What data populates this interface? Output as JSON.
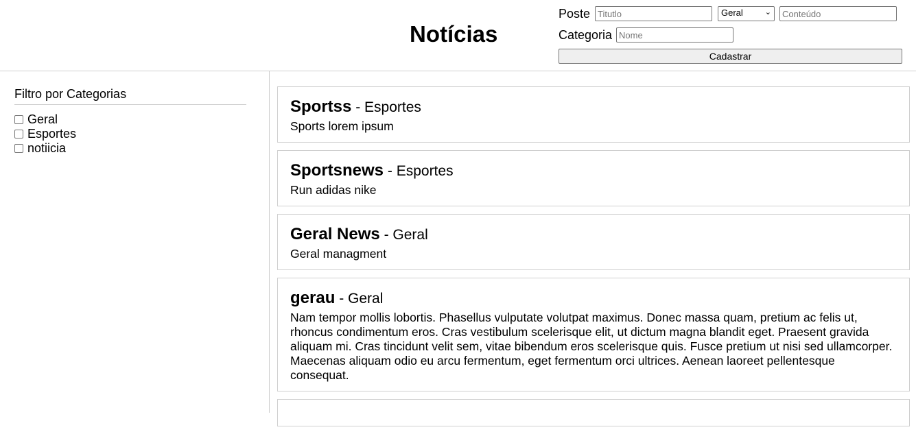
{
  "header": {
    "title": "Notícias",
    "form": {
      "poste_label": "Poste",
      "titulo_placeholder": "Titutlo",
      "category_select_value": "Geral",
      "conteudo_placeholder": "Conteúdo",
      "categoria_label": "Categoria",
      "nome_placeholder": "Nome",
      "submit_label": "Cadastrar"
    }
  },
  "sidebar": {
    "title": "Filtro por Categorias",
    "filters": [
      {
        "label": "Geral",
        "checked": false
      },
      {
        "label": "Esportes",
        "checked": false
      },
      {
        "label": "notiicia",
        "checked": false
      }
    ]
  },
  "news": [
    {
      "title": "Sportss",
      "separator": " - ",
      "category": "Esportes",
      "body": "Sports lorem ipsum"
    },
    {
      "title": "Sportsnews",
      "separator": " - ",
      "category": "Esportes",
      "body": "Run adidas nike"
    },
    {
      "title": "Geral News",
      "separator": " - ",
      "category": "Geral",
      "body": "Geral managment"
    },
    {
      "title": "gerau",
      "separator": " - ",
      "category": "Geral",
      "body": "Nam tempor mollis lobortis. Phasellus vulputate volutpat maximus. Donec massa quam, pretium ac felis ut, rhoncus condimentum eros. Cras vestibulum scelerisque elit, ut dictum magna blandit eget. Praesent gravida aliquam mi. Cras tincidunt velit sem, vitae bibendum eros scelerisque quis. Fusce pretium ut nisi sed ullamcorper. Maecenas aliquam odio eu arcu fermentum, eget fermentum orci ultrices. Aenean laoreet pellentesque consequat."
    },
    {
      "title": "",
      "separator": "",
      "category": "",
      "body": ""
    }
  ]
}
